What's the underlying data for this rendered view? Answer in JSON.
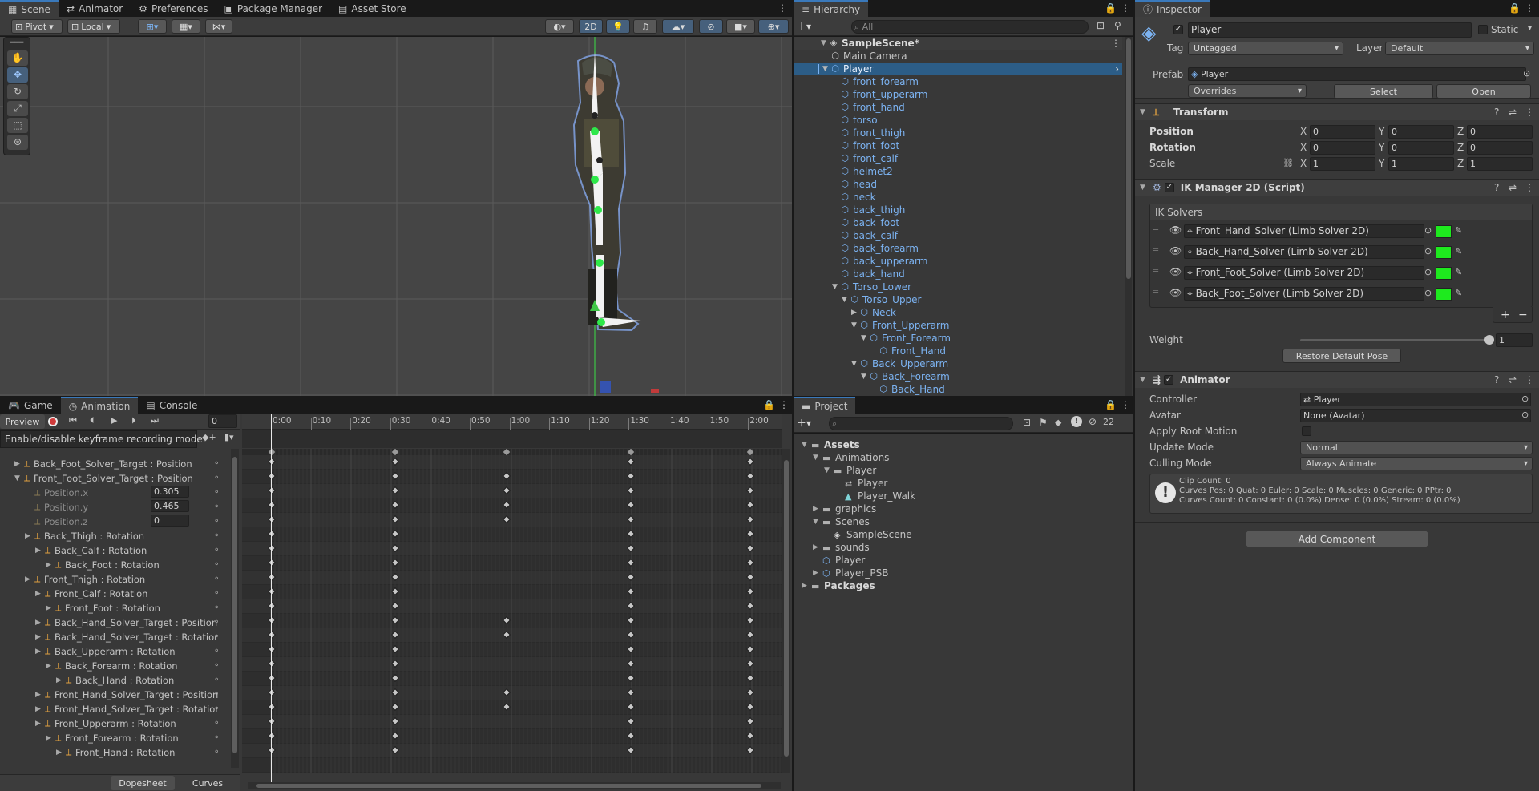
{
  "scene_tabs": {
    "scene": "Scene",
    "animator": "Animator",
    "preferences": "Preferences",
    "package_manager": "Package Manager",
    "asset_store": "Asset Store"
  },
  "scene_toolbar": {
    "pivot": "Pivot",
    "local": "Local",
    "mode_2d": "2D"
  },
  "hierarchy": {
    "tab": "Hierarchy",
    "search_placeholder": "All",
    "scene": "SampleScene*",
    "items": [
      {
        "label": "Main Camera",
        "depth": 1,
        "arrow": "",
        "blue": false,
        "selected": false
      },
      {
        "label": "Player",
        "depth": 1,
        "arrow": "▼",
        "blue": true,
        "selected": true
      },
      {
        "label": "front_forearm",
        "depth": 2,
        "arrow": "",
        "blue": true,
        "selected": false
      },
      {
        "label": "front_upperarm",
        "depth": 2,
        "arrow": "",
        "blue": true,
        "selected": false
      },
      {
        "label": "front_hand",
        "depth": 2,
        "arrow": "",
        "blue": true,
        "selected": false
      },
      {
        "label": "torso",
        "depth": 2,
        "arrow": "",
        "blue": true,
        "selected": false
      },
      {
        "label": "front_thigh",
        "depth": 2,
        "arrow": "",
        "blue": true,
        "selected": false
      },
      {
        "label": "front_foot",
        "depth": 2,
        "arrow": "",
        "blue": true,
        "selected": false
      },
      {
        "label": "front_calf",
        "depth": 2,
        "arrow": "",
        "blue": true,
        "selected": false
      },
      {
        "label": "helmet2",
        "depth": 2,
        "arrow": "",
        "blue": true,
        "selected": false
      },
      {
        "label": "head",
        "depth": 2,
        "arrow": "",
        "blue": true,
        "selected": false
      },
      {
        "label": "neck",
        "depth": 2,
        "arrow": "",
        "blue": true,
        "selected": false
      },
      {
        "label": "back_thigh",
        "depth": 2,
        "arrow": "",
        "blue": true,
        "selected": false
      },
      {
        "label": "back_foot",
        "depth": 2,
        "arrow": "",
        "blue": true,
        "selected": false
      },
      {
        "label": "back_calf",
        "depth": 2,
        "arrow": "",
        "blue": true,
        "selected": false
      },
      {
        "label": "back_forearm",
        "depth": 2,
        "arrow": "",
        "blue": true,
        "selected": false
      },
      {
        "label": "back_upperarm",
        "depth": 2,
        "arrow": "",
        "blue": true,
        "selected": false
      },
      {
        "label": "back_hand",
        "depth": 2,
        "arrow": "",
        "blue": true,
        "selected": false
      },
      {
        "label": "Torso_Lower",
        "depth": 2,
        "arrow": "▼",
        "blue": true,
        "selected": false
      },
      {
        "label": "Torso_Upper",
        "depth": 3,
        "arrow": "▼",
        "blue": true,
        "selected": false
      },
      {
        "label": "Neck",
        "depth": 4,
        "arrow": "▶",
        "blue": true,
        "selected": false
      },
      {
        "label": "Front_Upperarm",
        "depth": 4,
        "arrow": "▼",
        "blue": true,
        "selected": false
      },
      {
        "label": "Front_Forearm",
        "depth": 5,
        "arrow": "▼",
        "blue": true,
        "selected": false
      },
      {
        "label": "Front_Hand",
        "depth": 6,
        "arrow": "",
        "blue": true,
        "selected": false
      },
      {
        "label": "Back_Upperarm",
        "depth": 4,
        "arrow": "▼",
        "blue": true,
        "selected": false
      },
      {
        "label": "Back_Forearm",
        "depth": 5,
        "arrow": "▼",
        "blue": true,
        "selected": false
      },
      {
        "label": "Back_Hand",
        "depth": 6,
        "arrow": "",
        "blue": true,
        "selected": false
      }
    ]
  },
  "inspector": {
    "tab": "Inspector",
    "name": "Player",
    "static_label": "Static",
    "tag_label": "Tag",
    "tag_value": "Untagged",
    "layer_label": "Layer",
    "layer_value": "Default",
    "prefab_label": "Prefab",
    "prefab_value": "Player",
    "overrides": "Overrides",
    "select": "Select",
    "open": "Open",
    "transform": {
      "title": "Transform",
      "position_label": "Position",
      "rotation_label": "Rotation",
      "scale_label": "Scale",
      "x": "X",
      "y": "Y",
      "z": "Z",
      "position": [
        "0",
        "0",
        "0"
      ],
      "rotation": [
        "0",
        "0",
        "0"
      ],
      "scale": [
        "1",
        "1",
        "1"
      ]
    },
    "ik": {
      "title": "IK Manager 2D (Script)",
      "solvers_label": "IK Solvers",
      "solvers": [
        "Front_Hand_Solver (Limb Solver 2D)",
        "Back_Hand_Solver (Limb Solver 2D)",
        "Front_Foot_Solver (Limb Solver 2D)",
        "Back_Foot_Solver (Limb Solver 2D)"
      ],
      "add": "+",
      "remove": "−",
      "weight_label": "Weight",
      "weight_value": "1",
      "restore": "Restore Default Pose"
    },
    "animator": {
      "title": "Animator",
      "controller_label": "Controller",
      "controller_value": "Player",
      "avatar_label": "Avatar",
      "avatar_value": "None (Avatar)",
      "root_motion_label": "Apply Root Motion",
      "update_label": "Update Mode",
      "update_value": "Normal",
      "culling_label": "Culling Mode",
      "culling_value": "Always Animate",
      "info_1": "Clip Count: 0",
      "info_2": "Curves Pos: 0 Quat: 0 Euler: 0 Scale: 0 Muscles: 0 Generic: 0 PPtr: 0",
      "info_3": "Curves Count: 0 Constant: 0 (0.0%) Dense: 0 (0.0%) Stream: 0 (0.0%)"
    },
    "add_component": "Add Component"
  },
  "bottom_tabs": {
    "game": "Game",
    "animation": "Animation",
    "console": "Console"
  },
  "animation": {
    "preview": "Preview",
    "frame": "0",
    "tooltip": "Enable/disable keyframe recording mode.",
    "ruler": [
      "0:00",
      "0:10",
      "0:20",
      "0:30",
      "0:40",
      "0:50",
      "1:00",
      "1:10",
      "1:20",
      "1:30",
      "1:40",
      "1:50",
      "2:00"
    ],
    "properties": [
      {
        "label": "Back_Foot_Solver_Target : Position",
        "indent": 0,
        "arrow": "▶",
        "dim": false,
        "value": ""
      },
      {
        "label": "Front_Foot_Solver_Target : Position",
        "indent": 0,
        "arrow": "▼",
        "dim": false,
        "value": ""
      },
      {
        "label": "Position.x",
        "indent": 1,
        "arrow": "",
        "dim": true,
        "value": "0.305"
      },
      {
        "label": "Position.y",
        "indent": 1,
        "arrow": "",
        "dim": true,
        "value": "0.465"
      },
      {
        "label": "Position.z",
        "indent": 1,
        "arrow": "",
        "dim": true,
        "value": "0"
      },
      {
        "label": "Back_Thigh : Rotation",
        "indent": 1,
        "arrow": "▶",
        "dim": false,
        "value": ""
      },
      {
        "label": "Back_Calf : Rotation",
        "indent": 2,
        "arrow": "▶",
        "dim": false,
        "value": ""
      },
      {
        "label": "Back_Foot : Rotation",
        "indent": 3,
        "arrow": "▶",
        "dim": false,
        "value": ""
      },
      {
        "label": "Front_Thigh : Rotation",
        "indent": 1,
        "arrow": "▶",
        "dim": false,
        "value": ""
      },
      {
        "label": "Front_Calf : Rotation",
        "indent": 2,
        "arrow": "▶",
        "dim": false,
        "value": ""
      },
      {
        "label": "Front_Foot : Rotation",
        "indent": 3,
        "arrow": "▶",
        "dim": false,
        "value": ""
      },
      {
        "label": "Back_Hand_Solver_Target : Position",
        "indent": 2,
        "arrow": "▶",
        "dim": false,
        "value": ""
      },
      {
        "label": "Back_Hand_Solver_Target : Rotation",
        "indent": 2,
        "arrow": "▶",
        "dim": false,
        "value": ""
      },
      {
        "label": "Back_Upperarm : Rotation",
        "indent": 2,
        "arrow": "▶",
        "dim": false,
        "value": ""
      },
      {
        "label": "Back_Forearm : Rotation",
        "indent": 3,
        "arrow": "▶",
        "dim": false,
        "value": ""
      },
      {
        "label": "Back_Hand : Rotation",
        "indent": 4,
        "arrow": "▶",
        "dim": false,
        "value": ""
      },
      {
        "label": "Front_Hand_Solver_Target : Position",
        "indent": 2,
        "arrow": "▶",
        "dim": false,
        "value": ""
      },
      {
        "label": "Front_Hand_Solver_Target : Rotation",
        "indent": 2,
        "arrow": "▶",
        "dim": false,
        "value": ""
      },
      {
        "label": "Front_Upperarm : Rotation",
        "indent": 2,
        "arrow": "▶",
        "dim": false,
        "value": ""
      },
      {
        "label": "Front_Forearm : Rotation",
        "indent": 3,
        "arrow": "▶",
        "dim": false,
        "value": ""
      },
      {
        "label": "Front_Hand : Rotation",
        "indent": 4,
        "arrow": "▶",
        "dim": false,
        "value": ""
      }
    ],
    "dopesheet": "Dopesheet",
    "curves": "Curves"
  },
  "project": {
    "tab": "Project",
    "hidden_count": "22",
    "tree": [
      {
        "label": "Assets",
        "depth": 0,
        "arrow": "▼",
        "icon": "folder",
        "bold": true
      },
      {
        "label": "Animations",
        "depth": 1,
        "arrow": "▼",
        "icon": "folder",
        "bold": false
      },
      {
        "label": "Player",
        "depth": 2,
        "arrow": "▼",
        "icon": "folder",
        "bold": false
      },
      {
        "label": "Player",
        "depth": 3,
        "arrow": "",
        "icon": "anim-controller",
        "bold": false
      },
      {
        "label": "Player_Walk",
        "depth": 3,
        "arrow": "",
        "icon": "anim-clip",
        "bold": false
      },
      {
        "label": "graphics",
        "depth": 1,
        "arrow": "▶",
        "icon": "folder",
        "bold": false
      },
      {
        "label": "Scenes",
        "depth": 1,
        "arrow": "▼",
        "icon": "folder",
        "bold": false
      },
      {
        "label": "SampleScene",
        "depth": 2,
        "arrow": "",
        "icon": "unity",
        "bold": false
      },
      {
        "label": "sounds",
        "depth": 1,
        "arrow": "▶",
        "icon": "folder",
        "bold": false
      },
      {
        "label": "Player",
        "depth": 1,
        "arrow": "",
        "icon": "prefab",
        "bold": false
      },
      {
        "label": "Player_PSB",
        "depth": 1,
        "arrow": "▶",
        "icon": "prefab",
        "bold": false
      },
      {
        "label": "Packages",
        "depth": 0,
        "arrow": "▶",
        "icon": "folder",
        "bold": true
      }
    ]
  },
  "colors": {
    "accent": "#3a79bb",
    "selected_row": "#2c5d87",
    "bone_green": "#2ee84a",
    "solver_green": "#1eea1e",
    "prefab_blue": "#7cb3f2"
  }
}
